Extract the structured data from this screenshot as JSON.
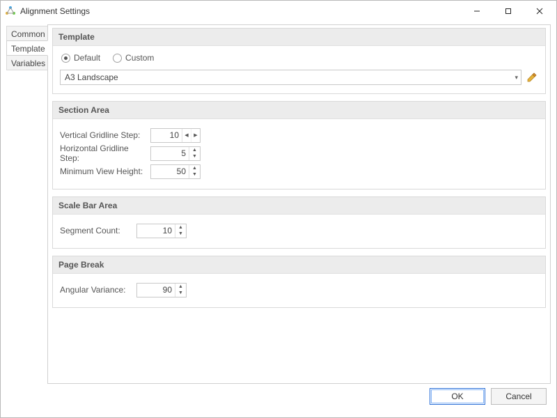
{
  "window": {
    "title": "Alignment Settings"
  },
  "tabs": {
    "items": [
      {
        "label": "Common"
      },
      {
        "label": "Template"
      },
      {
        "label": "Variables"
      }
    ],
    "active_index": 1
  },
  "template_group": {
    "title": "Template",
    "radio_default": "Default",
    "radio_custom": "Custom",
    "radio_selected": "default",
    "combo_value": "A3 Landscape"
  },
  "section_area_group": {
    "title": "Section Area",
    "vertical_label": "Vertical Gridline Step:",
    "vertical_value": "10",
    "horizontal_label": "Horizontal Gridline Step:",
    "horizontal_value": "5",
    "min_height_label": "Minimum View Height:",
    "min_height_value": "50"
  },
  "scale_bar_group": {
    "title": "Scale Bar Area",
    "segment_label": "Segment Count:",
    "segment_value": "10"
  },
  "page_break_group": {
    "title": "Page Break",
    "angular_label": "Angular Variance:",
    "angular_value": "90"
  },
  "footer": {
    "ok": "OK",
    "cancel": "Cancel"
  }
}
